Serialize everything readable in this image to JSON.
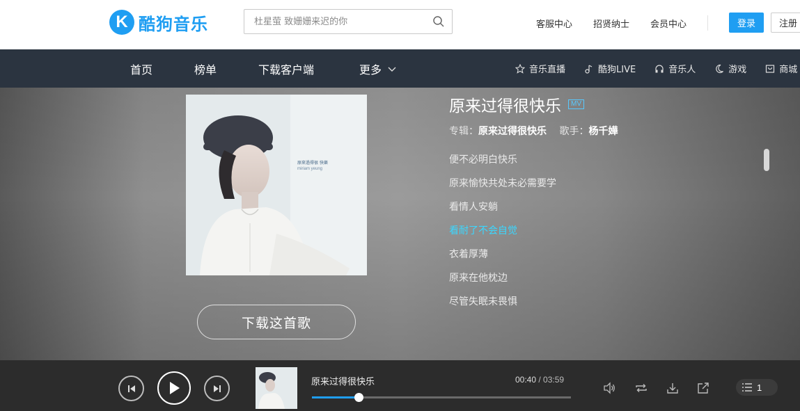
{
  "header": {
    "logo_letter": "K",
    "logo_text": "酷狗音乐",
    "search_placeholder": "杜星萤 致姗姗来迟的你",
    "links": [
      "客服中心",
      "招贤纳士",
      "会员中心"
    ],
    "login_label": "登录",
    "register_label": "注册"
  },
  "nav": {
    "main": [
      "首页",
      "榜单",
      "下载客户端",
      "更多"
    ],
    "right": [
      {
        "label": "音乐直播",
        "icon": "star-icon"
      },
      {
        "label": "酷狗LIVE",
        "icon": "music-note-icon"
      },
      {
        "label": "音乐人",
        "icon": "headphones-icon"
      },
      {
        "label": "游戏",
        "icon": "moon-icon"
      },
      {
        "label": "商城",
        "icon": "bag-icon"
      }
    ]
  },
  "song": {
    "title": "原来过得很快乐",
    "mv_badge": "MV",
    "album_label": "专辑：",
    "album": "原来过得很快乐",
    "singer_label": "歌手：",
    "singer": "杨千嬅",
    "cover_text_line1": "原來過得很 快樂",
    "cover_text_line2": "miriam yeung",
    "download_label": "下载这首歌"
  },
  "lyrics": {
    "lines": [
      "便不必明白快乐",
      "原来愉快共处未必需要学",
      "看情人安躺",
      "看耐了不会自觉",
      "衣着厚薄",
      "原来在他枕边",
      "尽管失眠未畏惧"
    ],
    "active_index": 3
  },
  "player": {
    "title": "原来过得很快乐",
    "current_time": "00:40",
    "separator": " / ",
    "total_time": "03:59",
    "progress": 0.18,
    "queue_count": "1"
  },
  "colors": {
    "accent": "#1f9ef2",
    "active_lyric": "#3ad7ff",
    "nav_bg": "#2b3440",
    "player_bg": "#2c2c2c"
  }
}
